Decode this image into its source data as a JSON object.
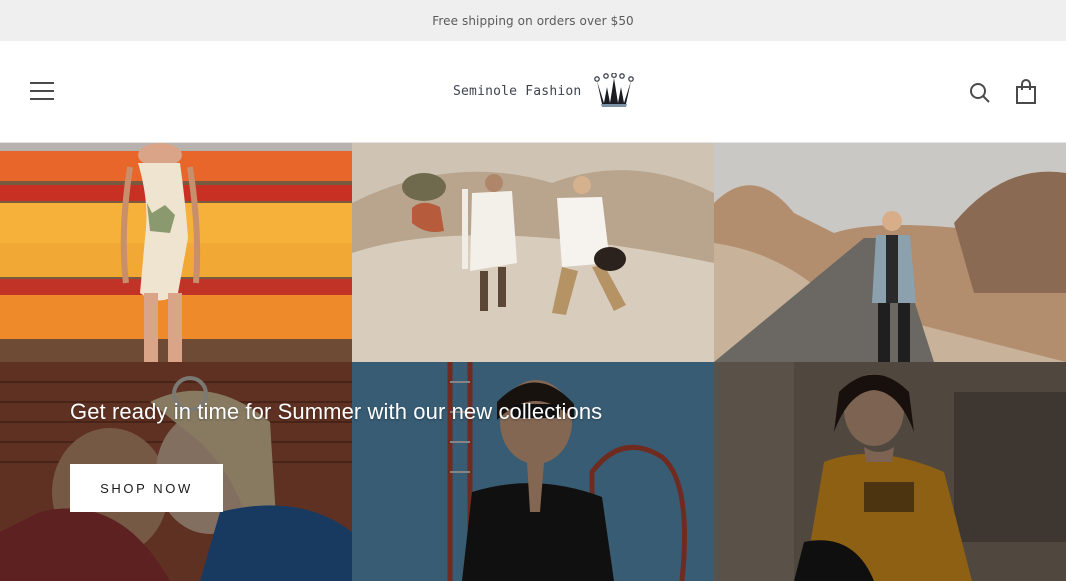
{
  "announcement": {
    "text": "Free shipping on orders over $50"
  },
  "header": {
    "logo_text": "Seminole Fashion",
    "menu_icon": "hamburger-menu-icon",
    "search_icon": "search-icon",
    "cart_icon": "shopping-bag-icon"
  },
  "hero": {
    "title": "Get ready in time for Summer with our new collections",
    "button_label": "SHOP NOW",
    "tiles": [
      {
        "subject": "woman-in-swimsuit-by-kayaks"
      },
      {
        "subject": "couple-running-in-desert"
      },
      {
        "subject": "man-on-canyon-road"
      },
      {
        "subject": "two-friends-by-brick-wall"
      },
      {
        "subject": "woman-by-roller-coaster"
      },
      {
        "subject": "woman-in-orange-hoodie"
      }
    ]
  },
  "colors": {
    "announcement_bg": "#efefef",
    "text_dark": "#1c1b1b",
    "logo_color": "#3e4450",
    "button_bg": "#ffffff"
  }
}
